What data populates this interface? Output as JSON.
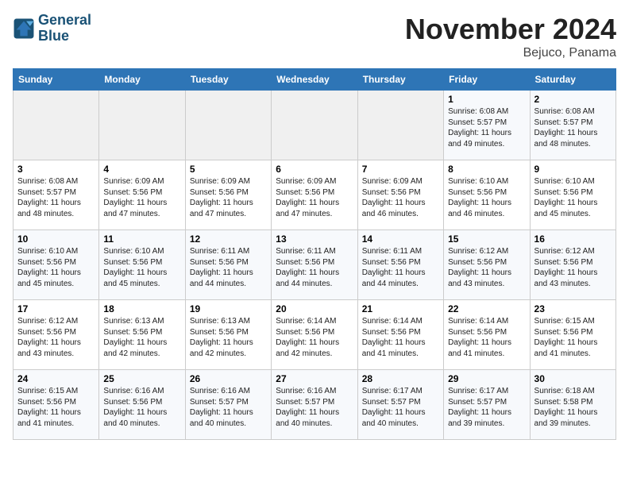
{
  "header": {
    "logo_line1": "General",
    "logo_line2": "Blue",
    "month": "November 2024",
    "location": "Bejuco, Panama"
  },
  "weekdays": [
    "Sunday",
    "Monday",
    "Tuesday",
    "Wednesday",
    "Thursday",
    "Friday",
    "Saturday"
  ],
  "weeks": [
    [
      {
        "day": "",
        "info": ""
      },
      {
        "day": "",
        "info": ""
      },
      {
        "day": "",
        "info": ""
      },
      {
        "day": "",
        "info": ""
      },
      {
        "day": "",
        "info": ""
      },
      {
        "day": "1",
        "info": "Sunrise: 6:08 AM\nSunset: 5:57 PM\nDaylight: 11 hours and 49 minutes."
      },
      {
        "day": "2",
        "info": "Sunrise: 6:08 AM\nSunset: 5:57 PM\nDaylight: 11 hours and 48 minutes."
      }
    ],
    [
      {
        "day": "3",
        "info": "Sunrise: 6:08 AM\nSunset: 5:57 PM\nDaylight: 11 hours and 48 minutes."
      },
      {
        "day": "4",
        "info": "Sunrise: 6:09 AM\nSunset: 5:56 PM\nDaylight: 11 hours and 47 minutes."
      },
      {
        "day": "5",
        "info": "Sunrise: 6:09 AM\nSunset: 5:56 PM\nDaylight: 11 hours and 47 minutes."
      },
      {
        "day": "6",
        "info": "Sunrise: 6:09 AM\nSunset: 5:56 PM\nDaylight: 11 hours and 47 minutes."
      },
      {
        "day": "7",
        "info": "Sunrise: 6:09 AM\nSunset: 5:56 PM\nDaylight: 11 hours and 46 minutes."
      },
      {
        "day": "8",
        "info": "Sunrise: 6:10 AM\nSunset: 5:56 PM\nDaylight: 11 hours and 46 minutes."
      },
      {
        "day": "9",
        "info": "Sunrise: 6:10 AM\nSunset: 5:56 PM\nDaylight: 11 hours and 45 minutes."
      }
    ],
    [
      {
        "day": "10",
        "info": "Sunrise: 6:10 AM\nSunset: 5:56 PM\nDaylight: 11 hours and 45 minutes."
      },
      {
        "day": "11",
        "info": "Sunrise: 6:10 AM\nSunset: 5:56 PM\nDaylight: 11 hours and 45 minutes."
      },
      {
        "day": "12",
        "info": "Sunrise: 6:11 AM\nSunset: 5:56 PM\nDaylight: 11 hours and 44 minutes."
      },
      {
        "day": "13",
        "info": "Sunrise: 6:11 AM\nSunset: 5:56 PM\nDaylight: 11 hours and 44 minutes."
      },
      {
        "day": "14",
        "info": "Sunrise: 6:11 AM\nSunset: 5:56 PM\nDaylight: 11 hours and 44 minutes."
      },
      {
        "day": "15",
        "info": "Sunrise: 6:12 AM\nSunset: 5:56 PM\nDaylight: 11 hours and 43 minutes."
      },
      {
        "day": "16",
        "info": "Sunrise: 6:12 AM\nSunset: 5:56 PM\nDaylight: 11 hours and 43 minutes."
      }
    ],
    [
      {
        "day": "17",
        "info": "Sunrise: 6:12 AM\nSunset: 5:56 PM\nDaylight: 11 hours and 43 minutes."
      },
      {
        "day": "18",
        "info": "Sunrise: 6:13 AM\nSunset: 5:56 PM\nDaylight: 11 hours and 42 minutes."
      },
      {
        "day": "19",
        "info": "Sunrise: 6:13 AM\nSunset: 5:56 PM\nDaylight: 11 hours and 42 minutes."
      },
      {
        "day": "20",
        "info": "Sunrise: 6:14 AM\nSunset: 5:56 PM\nDaylight: 11 hours and 42 minutes."
      },
      {
        "day": "21",
        "info": "Sunrise: 6:14 AM\nSunset: 5:56 PM\nDaylight: 11 hours and 41 minutes."
      },
      {
        "day": "22",
        "info": "Sunrise: 6:14 AM\nSunset: 5:56 PM\nDaylight: 11 hours and 41 minutes."
      },
      {
        "day": "23",
        "info": "Sunrise: 6:15 AM\nSunset: 5:56 PM\nDaylight: 11 hours and 41 minutes."
      }
    ],
    [
      {
        "day": "24",
        "info": "Sunrise: 6:15 AM\nSunset: 5:56 PM\nDaylight: 11 hours and 41 minutes."
      },
      {
        "day": "25",
        "info": "Sunrise: 6:16 AM\nSunset: 5:56 PM\nDaylight: 11 hours and 40 minutes."
      },
      {
        "day": "26",
        "info": "Sunrise: 6:16 AM\nSunset: 5:57 PM\nDaylight: 11 hours and 40 minutes."
      },
      {
        "day": "27",
        "info": "Sunrise: 6:16 AM\nSunset: 5:57 PM\nDaylight: 11 hours and 40 minutes."
      },
      {
        "day": "28",
        "info": "Sunrise: 6:17 AM\nSunset: 5:57 PM\nDaylight: 11 hours and 40 minutes."
      },
      {
        "day": "29",
        "info": "Sunrise: 6:17 AM\nSunset: 5:57 PM\nDaylight: 11 hours and 39 minutes."
      },
      {
        "day": "30",
        "info": "Sunrise: 6:18 AM\nSunset: 5:58 PM\nDaylight: 11 hours and 39 minutes."
      }
    ]
  ]
}
